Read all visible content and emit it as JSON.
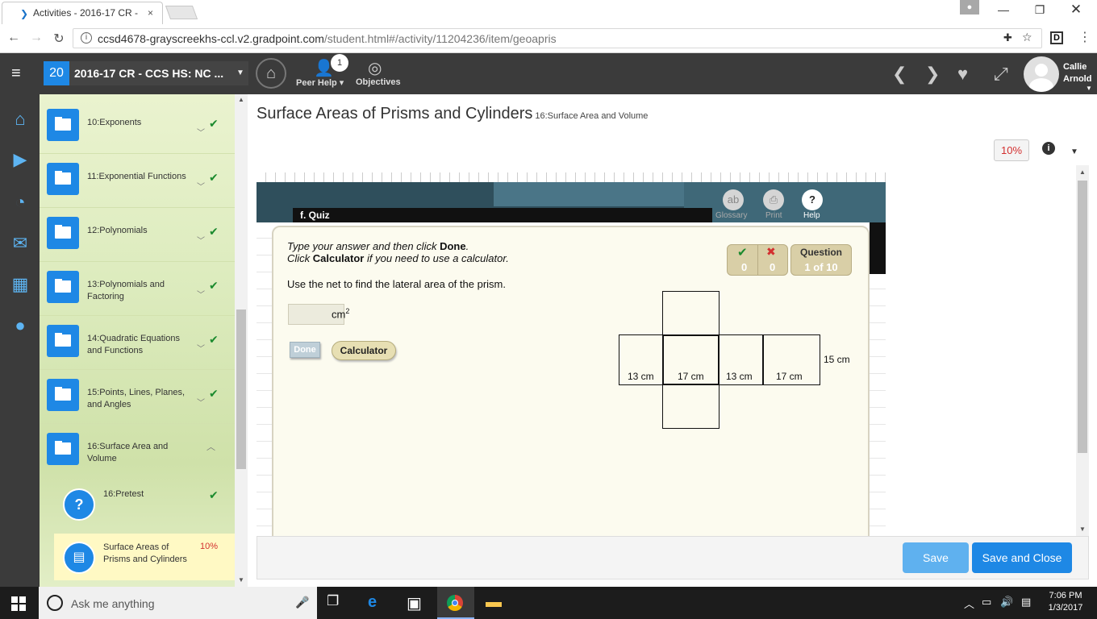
{
  "browser": {
    "tab_title": "Activities - 2016-17 CR -",
    "tab_close": "×",
    "url_host": "ccsd4678-grayscreekhs-ccl.v2.gradpoint.com",
    "url_path": "/student.html#/activity/11204236/item/geoapris"
  },
  "header": {
    "course_number": "20",
    "course_name": "2016-17 CR - CCS HS: NC ...",
    "peer_help_label": "Peer Help",
    "peer_help_badge": "1",
    "objectives_label": "Objectives",
    "user_first": "Callie",
    "user_last": "Arnold"
  },
  "sidebar": {
    "items": [
      {
        "label": "10:Exponents"
      },
      {
        "label": "11:Exponential Functions"
      },
      {
        "label": "12:Polynomials"
      },
      {
        "label": "13:Polynomials and Factoring"
      },
      {
        "label": "14:Quadratic Equations and Functions"
      },
      {
        "label": "15:Points, Lines, Planes, and Angles"
      },
      {
        "label": "16:Surface Area and Volume"
      }
    ],
    "pretest_label": "16:Pretest",
    "active_label": "Surface Areas of Prisms and Cylinders",
    "active_progress": "10%"
  },
  "page": {
    "title": "Surface Areas of Prisms and Cylinders",
    "subtitle": "16:Surface Area and Volume",
    "progress": "10%"
  },
  "quiz": {
    "banner_label": "f. Quiz",
    "tools": [
      "Glossary",
      "Print",
      "Help"
    ],
    "instruction_line1_a": "Type your answer and then click ",
    "instruction_line1_b": "Done",
    "instruction_line1_c": ".",
    "instruction_line2_a": "Click ",
    "instruction_line2_b": "Calculator",
    "instruction_line2_c": " if you need to use a calculator.",
    "question": "Use the net to find the lateral area of the prism.",
    "answer_unit": "cm",
    "answer_unit_exp": "2",
    "done_label": "Done",
    "calculator_label": "Calculator",
    "correct_count": "0",
    "incorrect_count": "0",
    "question_label": "Question",
    "question_progress": "1 of 10",
    "net_labels": {
      "a": "13 cm",
      "b": "17 cm",
      "c": "13 cm",
      "d": "17 cm",
      "height": "15 cm"
    }
  },
  "footer": {
    "save_label": "Save",
    "save_close_label": "Save and Close"
  },
  "taskbar": {
    "search_placeholder": "Ask me anything",
    "time": "7:06 PM",
    "date": "1/3/2017"
  }
}
